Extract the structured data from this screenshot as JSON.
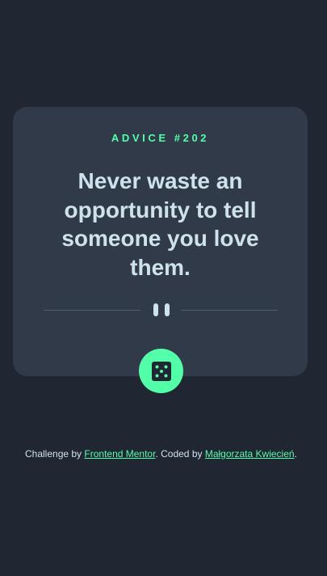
{
  "card": {
    "advice_label": "ADVICE #202",
    "quote": "Never waste an opportunity to tell someone you love them."
  },
  "divider": {
    "icon": "pause-icon"
  },
  "dice_button": {
    "icon": "dice-icon"
  },
  "attribution": {
    "prefix": "Challenge by ",
    "link1": "Frontend Mentor",
    "middle": ". Coded by ",
    "link2": "Małgorzata Kwiecień",
    "suffix": "."
  },
  "colors": {
    "background": "#202632",
    "card": "#313a49",
    "accent": "#52ffa8",
    "text": "#cee3e9",
    "divider": "#4f5d74"
  }
}
